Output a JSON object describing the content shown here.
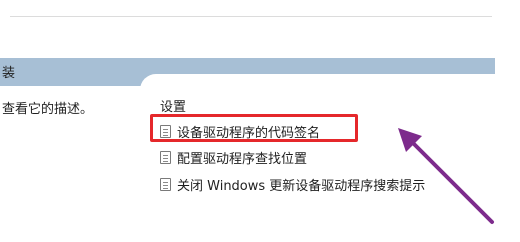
{
  "header": {
    "fragment": "装"
  },
  "left_pane": {
    "description_fragment": "查看它的描述。"
  },
  "settings_panel": {
    "heading": "设置",
    "items": [
      {
        "label": "设备驱动程序的代码签名",
        "icon": "policy-icon",
        "highlighted": true
      },
      {
        "label": "配置驱动程序查找位置",
        "icon": "policy-icon",
        "highlighted": false
      },
      {
        "label": "关闭 Windows 更新设备驱动程序搜索提示",
        "icon": "policy-icon",
        "highlighted": false
      }
    ]
  },
  "annotations": {
    "highlight_color": "#e5282b",
    "arrow_color": "#7d2b8c"
  }
}
